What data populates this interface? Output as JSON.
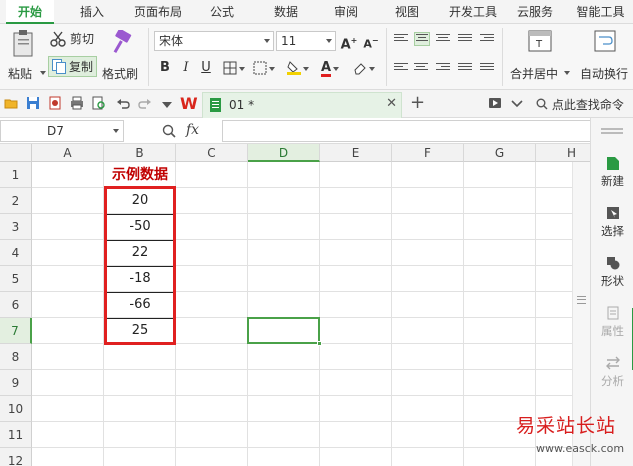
{
  "tabs": [
    "开始",
    "插入",
    "页面布局",
    "公式",
    "数据",
    "审阅",
    "视图",
    "开发工具",
    "云服务",
    "智能工具"
  ],
  "ribbon": {
    "cut_label": "剪切",
    "paste_label": "粘贴",
    "copy_label": "复制",
    "format_painter_label": "格式刷",
    "font_name": "宋体",
    "font_size": "11",
    "bold": "B",
    "italic": "I",
    "underline": "U",
    "grow_font": "A⁺",
    "shrink_font": "A⁻",
    "merge_center_label": "合并居中",
    "wrap_label": "自动换行"
  },
  "qat": {
    "doc_tab_label": "01 *",
    "search_command_label": "点此查找命令"
  },
  "formula_bar": {
    "name_box": "D7",
    "fx_label": "fx",
    "formula": ""
  },
  "columns": [
    "A",
    "B",
    "C",
    "D",
    "E",
    "F",
    "G",
    "H"
  ],
  "rows": [
    "1",
    "2",
    "3",
    "4",
    "5",
    "6",
    "7",
    "8",
    "9",
    "10",
    "11",
    "12"
  ],
  "sheet": {
    "header_title": "示例数据",
    "values": [
      "20",
      "-50",
      "22",
      "-18",
      "-66",
      "25"
    ]
  },
  "selected": {
    "column": "D",
    "row": "7"
  },
  "right_panel": [
    "新建",
    "选择",
    "形状",
    "属性",
    "分析"
  ],
  "watermark": {
    "title": "易采站长站",
    "url": "www.easck.com"
  },
  "colors": {
    "accent_green": "#2a9a43",
    "red_border": "#e02020",
    "header_text_red": "#c00000",
    "watermark_red": "#d81e1e"
  }
}
